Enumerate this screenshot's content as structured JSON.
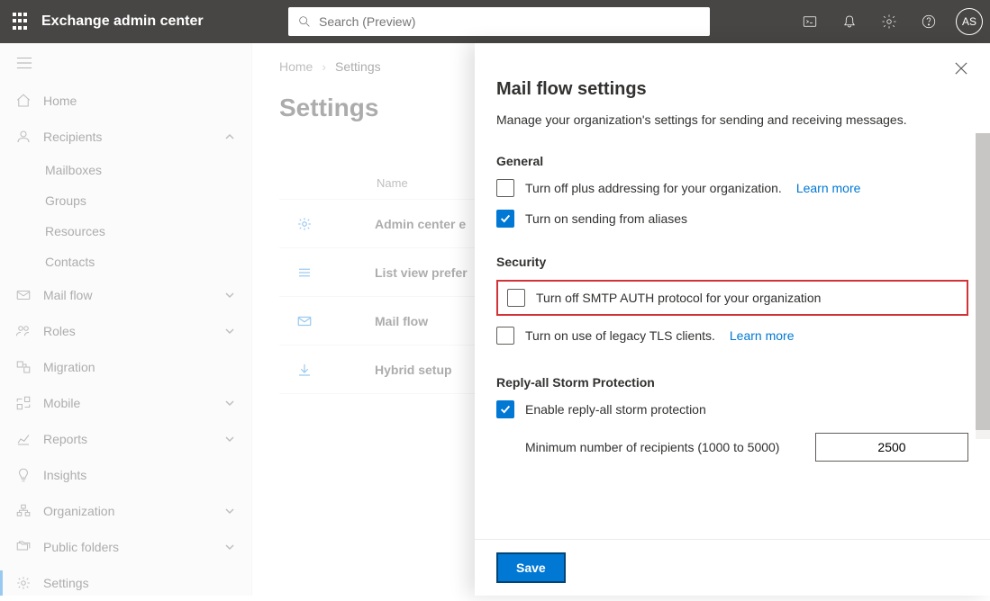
{
  "header": {
    "title": "Exchange admin center",
    "search_placeholder": "Search (Preview)",
    "avatar_initials": "AS"
  },
  "sidebar": {
    "items": [
      {
        "id": "home",
        "label": "Home",
        "icon": "home",
        "expandable": false
      },
      {
        "id": "recipients",
        "label": "Recipients",
        "icon": "person",
        "expandable": true,
        "expanded": true
      },
      {
        "id": "mailflow",
        "label": "Mail flow",
        "icon": "mail",
        "expandable": true
      },
      {
        "id": "roles",
        "label": "Roles",
        "icon": "roles",
        "expandable": true
      },
      {
        "id": "migration",
        "label": "Migration",
        "icon": "migration",
        "expandable": false
      },
      {
        "id": "mobile",
        "label": "Mobile",
        "icon": "mobile",
        "expandable": true
      },
      {
        "id": "reports",
        "label": "Reports",
        "icon": "reports",
        "expandable": true
      },
      {
        "id": "insights",
        "label": "Insights",
        "icon": "bulb",
        "expandable": false
      },
      {
        "id": "organization",
        "label": "Organization",
        "icon": "org",
        "expandable": true
      },
      {
        "id": "publicfolders",
        "label": "Public folders",
        "icon": "folders",
        "expandable": true
      },
      {
        "id": "settings",
        "label": "Settings",
        "icon": "gear",
        "expandable": false,
        "active": true
      }
    ],
    "recipients_children": [
      {
        "label": "Mailboxes"
      },
      {
        "label": "Groups"
      },
      {
        "label": "Resources"
      },
      {
        "label": "Contacts"
      }
    ]
  },
  "breadcrumb": {
    "home": "Home",
    "current": "Settings"
  },
  "page": {
    "title": "Settings",
    "column_header": "Name",
    "rows": [
      {
        "icon": "gear",
        "name": "Admin center e"
      },
      {
        "icon": "lines",
        "name": "List view prefer"
      },
      {
        "icon": "mail",
        "name": "Mail flow"
      },
      {
        "icon": "download",
        "name": "Hybrid setup"
      }
    ]
  },
  "panel": {
    "title": "Mail flow settings",
    "description": "Manage your organization's settings for sending and receiving messages.",
    "general": {
      "heading": "General",
      "plus_addressing": {
        "label": "Turn off plus addressing for your organization.",
        "checked": false,
        "learn": "Learn more"
      },
      "sending_aliases": {
        "label": "Turn on sending from aliases",
        "checked": true
      }
    },
    "security": {
      "heading": "Security",
      "smtp_auth": {
        "label": "Turn off SMTP AUTH protocol for your organization",
        "checked": false,
        "highlighted": true
      },
      "legacy_tls": {
        "label": "Turn on use of legacy TLS clients.",
        "checked": false,
        "learn": "Learn more"
      }
    },
    "storm": {
      "heading": "Reply-all Storm Protection",
      "enable": {
        "label": "Enable reply-all storm protection",
        "checked": true
      },
      "min_recipients": {
        "label": "Minimum number of recipients (1000 to 5000)",
        "value": "2500"
      }
    },
    "save_label": "Save"
  }
}
